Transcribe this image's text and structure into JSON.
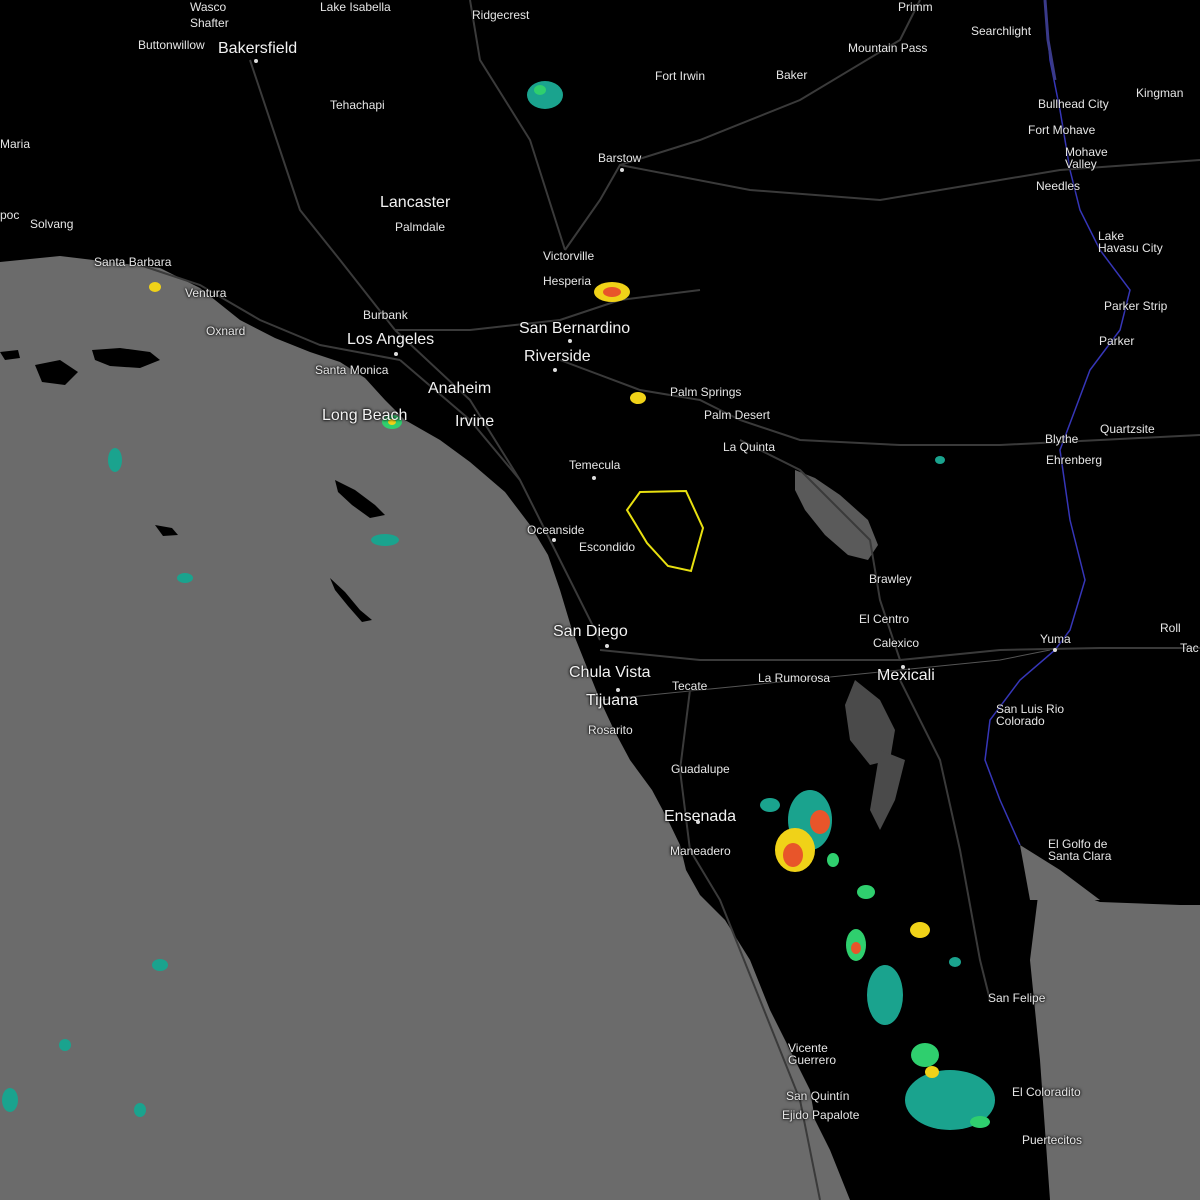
{
  "map": {
    "colors": {
      "land": "#000000",
      "water": "#6b6b6b",
      "roads": "#3a3a3a",
      "border": "#3636b8",
      "warning_polygon": "#e8e010",
      "radar_light": "#1aa38e",
      "radar_moderate": "#2fcf6e",
      "radar_heavy": "#f0d218",
      "radar_intense": "#e8552a"
    },
    "labels": {
      "ridgecrest": "Ridgecrest",
      "wasco": "Wasco",
      "shafter": "Shafter",
      "buttonwillow": "Buttonwillow",
      "bakersfield": "Bakersfield",
      "tehachapi": "Tehachapi",
      "maria": "Maria",
      "lancaster": "Lancaster",
      "palmdale": "Palmdale",
      "solvang": "Solvang",
      "poc": "poc",
      "santa_barbara": "Santa Barbara",
      "ventura": "Ventura",
      "oxnard": "Oxnard",
      "burbank": "Burbank",
      "los_angeles": "Los Angeles",
      "santa_monica": "Santa Monica",
      "anaheim": "Anaheim",
      "long_beach": "Long Beach",
      "irvine": "Irvine",
      "fort_irwin": "Fort Irwin",
      "baker": "Baker",
      "barstow": "Barstow",
      "victorville": "Victorville",
      "hesperia": "Hesperia",
      "san_bernardino": "San Bernardino",
      "riverside": "Riverside",
      "palm_springs": "Palm Springs",
      "palm_desert": "Palm Desert",
      "la_quinta": "La Quinta",
      "temecula": "Temecula",
      "oceanside": "Oceanside",
      "escondido": "Escondido",
      "san_diego": "San Diego",
      "chula_vista": "Chula Vista",
      "tijuana": "Tijuana",
      "rosarito": "Rosarito",
      "tecate": "Tecate",
      "la_rumorosa": "La Rumorosa",
      "guadalupe": "Guadalupe",
      "ensenada": "Ensenada",
      "maneadero": "Maneadero",
      "mountain_pass": "Mountain Pass",
      "searchlight": "Searchlight",
      "bullhead_city": "Bullhead City",
      "fort_mohave": "Fort Mohave",
      "mohave_valley": "Mohave\nValley",
      "needles": "Needles",
      "kingman": "Kingman",
      "lake_havasu_city": "Lake\nHavasu City",
      "parker_strip": "Parker Strip",
      "parker": "Parker",
      "blythe": "Blythe",
      "ehrenberg": "Ehrenberg",
      "quartzsite": "Quartzsite",
      "brawley": "Brawley",
      "el_centro": "El Centro",
      "calexico": "Calexico",
      "mexicali": "Mexicali",
      "yuma": "Yuma",
      "roll": "Roll",
      "tac": "Tac",
      "san_luis_rio_colorado": "San Luis Rio\nColorado",
      "el_golfo": "El Golfo de\nSanta Clara",
      "san_felipe": "San Felipe",
      "vicente_guerrero": "Vicente\nGuerrero",
      "san_quintin": "San Quintín",
      "ejido_papalote": "Ejido Papalote",
      "el_coloradito": "El Coloradito",
      "puertecitos": "Puertecitos",
      "primm": "Primm",
      "lake_isabella": "Lake Isabella"
    }
  }
}
